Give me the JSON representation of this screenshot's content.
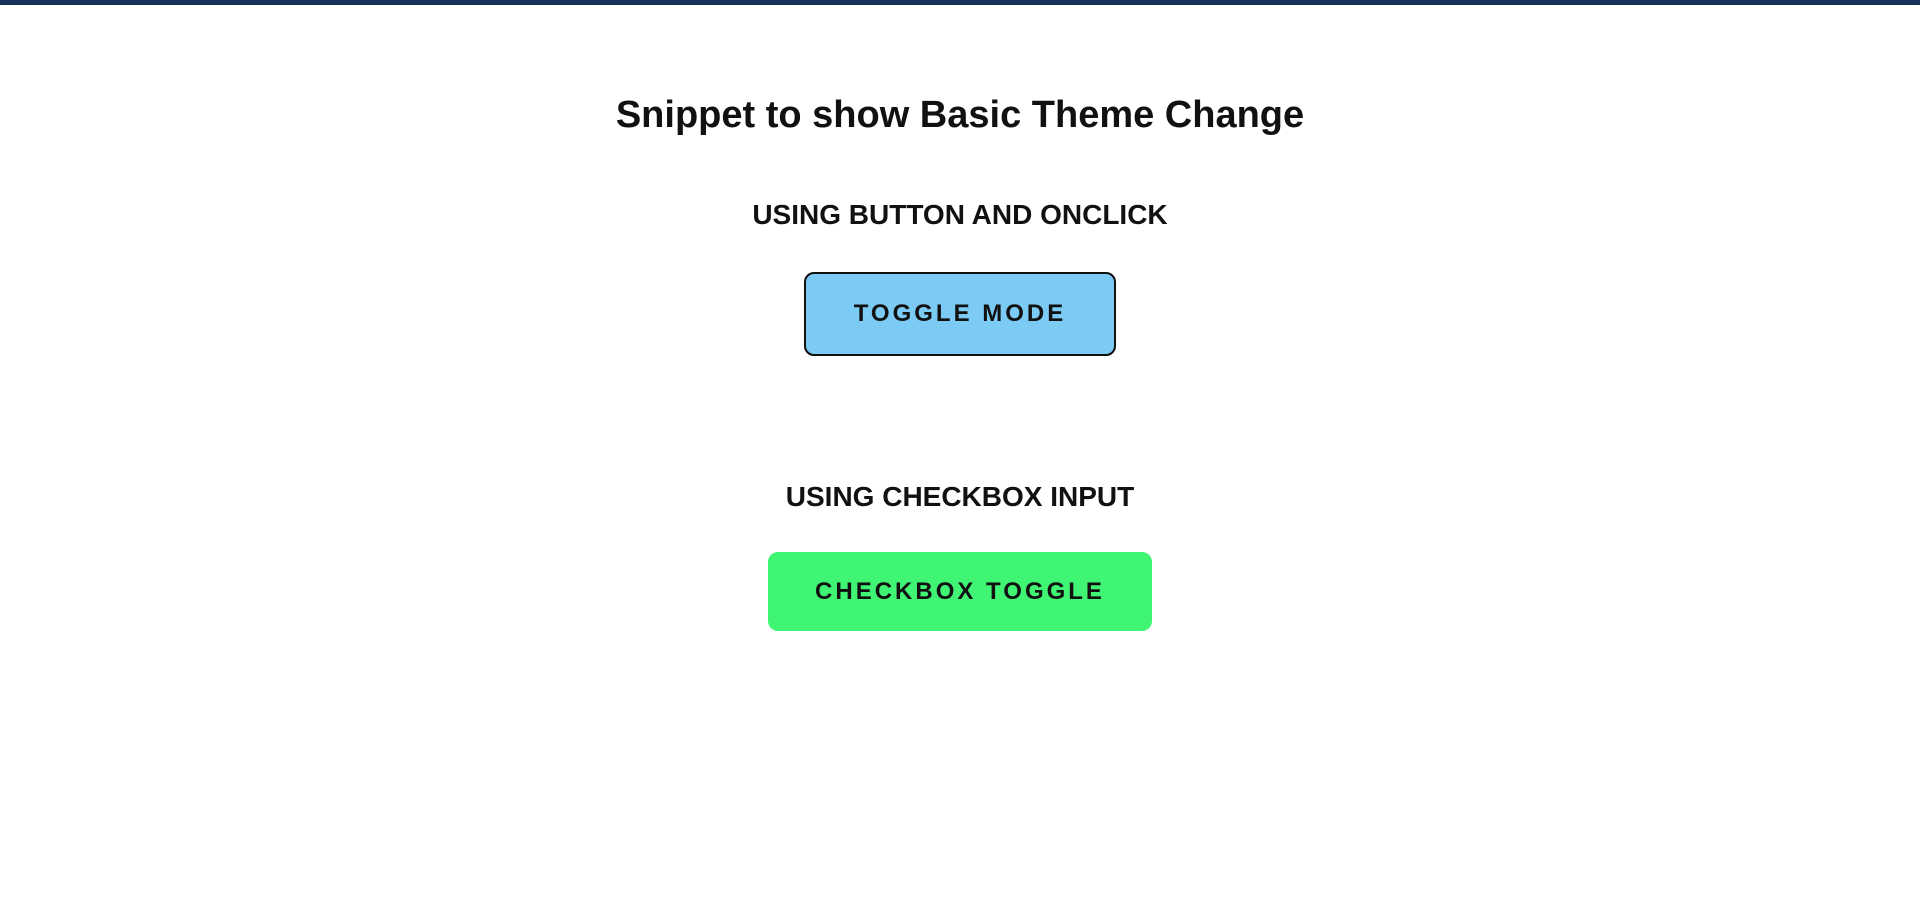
{
  "page": {
    "title": "Snippet to show Basic Theme Change"
  },
  "sections": {
    "button_section": {
      "heading": "USING BUTTON AND ONCLICK",
      "button_label": "TOGGLE MODE"
    },
    "checkbox_section": {
      "heading": "USING CHECKBOX INPUT",
      "toggle_label": "CHECKBOX TOGGLE",
      "checked": false
    }
  },
  "colors": {
    "top_bar": "#14325a",
    "toggle_mode_button": "#7bcbf4",
    "checkbox_toggle": "#40f574",
    "background": "#ffffff",
    "text": "#111111"
  }
}
